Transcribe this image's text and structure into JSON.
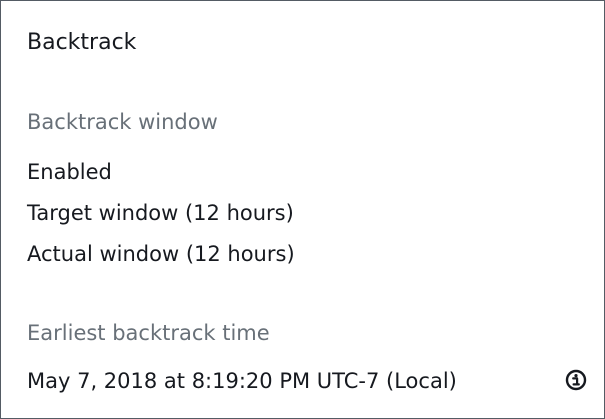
{
  "panel": {
    "title": "Backtrack",
    "backtrack_window": {
      "label": "Backtrack window",
      "lines": [
        "Enabled",
        "Target window (12 hours)",
        "Actual window (12 hours)"
      ]
    },
    "earliest_backtrack_time": {
      "label": "Earliest backtrack time",
      "value": "May 7, 2018 at 8:19:20 PM UTC-7 (Local)",
      "icon": "info-icon"
    }
  }
}
